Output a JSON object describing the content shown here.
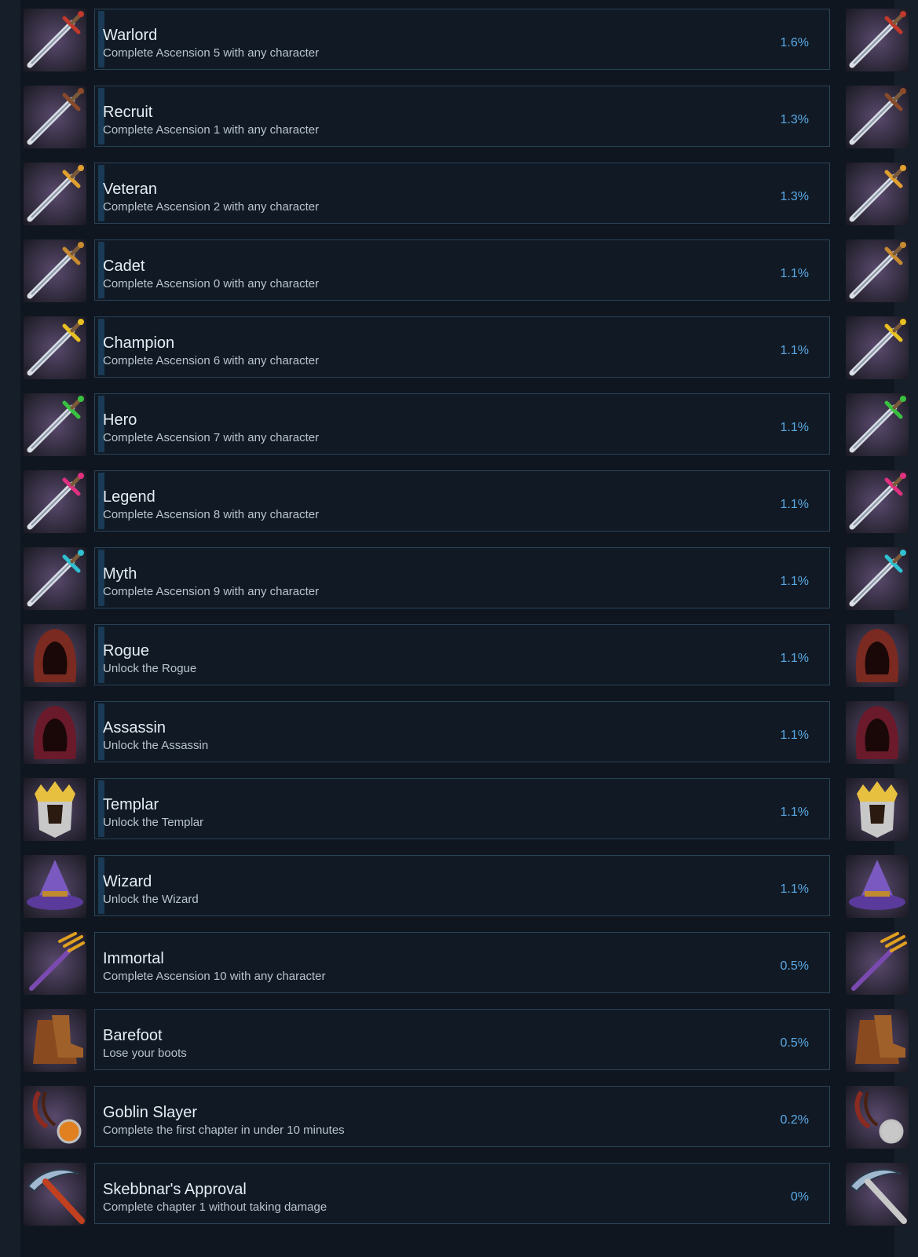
{
  "achievements": [
    {
      "name": "Warlord",
      "description": "Complete Ascension 5 with any character",
      "percent": "1.6%",
      "icon": "sword-icon",
      "icon_bg": "#5a4a6e",
      "accent": "#c0392b",
      "progress_bar": true
    },
    {
      "name": "Recruit",
      "description": "Complete Ascension 1 with any character",
      "percent": "1.3%",
      "icon": "sword-icon",
      "icon_bg": "#6e3a2a",
      "accent": "#8a4a2a",
      "progress_bar": true
    },
    {
      "name": "Veteran",
      "description": "Complete Ascension 2 with any character",
      "percent": "1.3%",
      "icon": "sword-icon",
      "icon_bg": "#6a5a3a",
      "accent": "#e0a030",
      "progress_bar": true
    },
    {
      "name": "Cadet",
      "description": "Complete Ascension 0 with any character",
      "percent": "1.1%",
      "icon": "sword-icon",
      "icon_bg": "#5a4a2a",
      "accent": "#c88a30",
      "progress_bar": true
    },
    {
      "name": "Champion",
      "description": "Complete Ascension 6 with any character",
      "percent": "1.1%",
      "icon": "sword-icon",
      "icon_bg": "#4a6a2a",
      "accent": "#e8c020",
      "progress_bar": true
    },
    {
      "name": "Hero",
      "description": "Complete Ascension 7 with any character",
      "percent": "1.1%",
      "icon": "sword-icon",
      "icon_bg": "#2a5a2a",
      "accent": "#3ac040",
      "progress_bar": true
    },
    {
      "name": "Legend",
      "description": "Complete Ascension 8 with any character",
      "percent": "1.1%",
      "icon": "sword-icon",
      "icon_bg": "#6a1a2a",
      "accent": "#e03080",
      "progress_bar": true
    },
    {
      "name": "Myth",
      "description": "Complete Ascension 9 with any character",
      "percent": "1.1%",
      "icon": "sword-icon",
      "icon_bg": "#1a4a5a",
      "accent": "#30c0d0",
      "progress_bar": true
    },
    {
      "name": "Rogue",
      "description": "Unlock the Rogue",
      "percent": "1.1%",
      "icon": "hood-icon",
      "icon_bg": "#c07050",
      "accent": "#7a2a20",
      "progress_bar": true
    },
    {
      "name": "Assassin",
      "description": "Unlock the Assassin",
      "percent": "1.1%",
      "icon": "hood-icon",
      "icon_bg": "#d0a0b0",
      "accent": "#6a1a2a",
      "progress_bar": true
    },
    {
      "name": "Templar",
      "description": "Unlock the Templar",
      "percent": "1.1%",
      "icon": "helmet-icon",
      "icon_bg": "#e09020",
      "accent": "#c8c8c8",
      "progress_bar": true
    },
    {
      "name": "Wizard",
      "description": "Unlock the Wizard",
      "percent": "1.1%",
      "icon": "wizard-hat-icon",
      "icon_bg": "#5a3a8a",
      "accent": "#7a5ac0",
      "progress_bar": true
    },
    {
      "name": "Immortal",
      "description": "Complete Ascension 10 with any character",
      "percent": "0.5%",
      "icon": "trident-icon",
      "icon_bg": "#3a2a5a",
      "accent": "#e0a020",
      "progress_bar": false
    },
    {
      "name": "Barefoot",
      "description": "Lose your boots",
      "percent": "0.5%",
      "icon": "boots-icon",
      "icon_bg": "#d06a20",
      "accent": "#8a4a20",
      "progress_bar": false
    },
    {
      "name": "Goblin Slayer",
      "description": "Complete the first chapter in under 10 minutes",
      "percent": "0.2%",
      "icon": "stopwatch-icon",
      "icon_bg": "#1a5a8a",
      "accent": "#e08020",
      "progress_bar": false,
      "right_icon_gray": true
    },
    {
      "name": "Skebbnar's Approval",
      "description": "Complete chapter 1 without taking damage",
      "percent": "0%",
      "icon": "pickaxe-icon",
      "icon_bg": "#d09020",
      "accent": "#c04020",
      "progress_bar": false,
      "right_icon_gray": true
    }
  ]
}
